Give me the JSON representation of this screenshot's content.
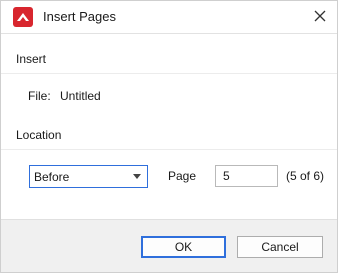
{
  "window": {
    "title": "Insert Pages"
  },
  "insert": {
    "section_label": "Insert",
    "file_label": "File:",
    "file_value": "Untitled"
  },
  "location": {
    "section_label": "Location",
    "position_selected": "Before",
    "page_label": "Page",
    "page_value": "5",
    "page_of_text": "(5 of 6)"
  },
  "buttons": {
    "ok_label": "OK",
    "cancel_label": "Cancel"
  },
  "colors": {
    "app_icon": "#d8262e",
    "focus_border": "#2f6fdc",
    "footer_bg": "#f0f0f0"
  }
}
